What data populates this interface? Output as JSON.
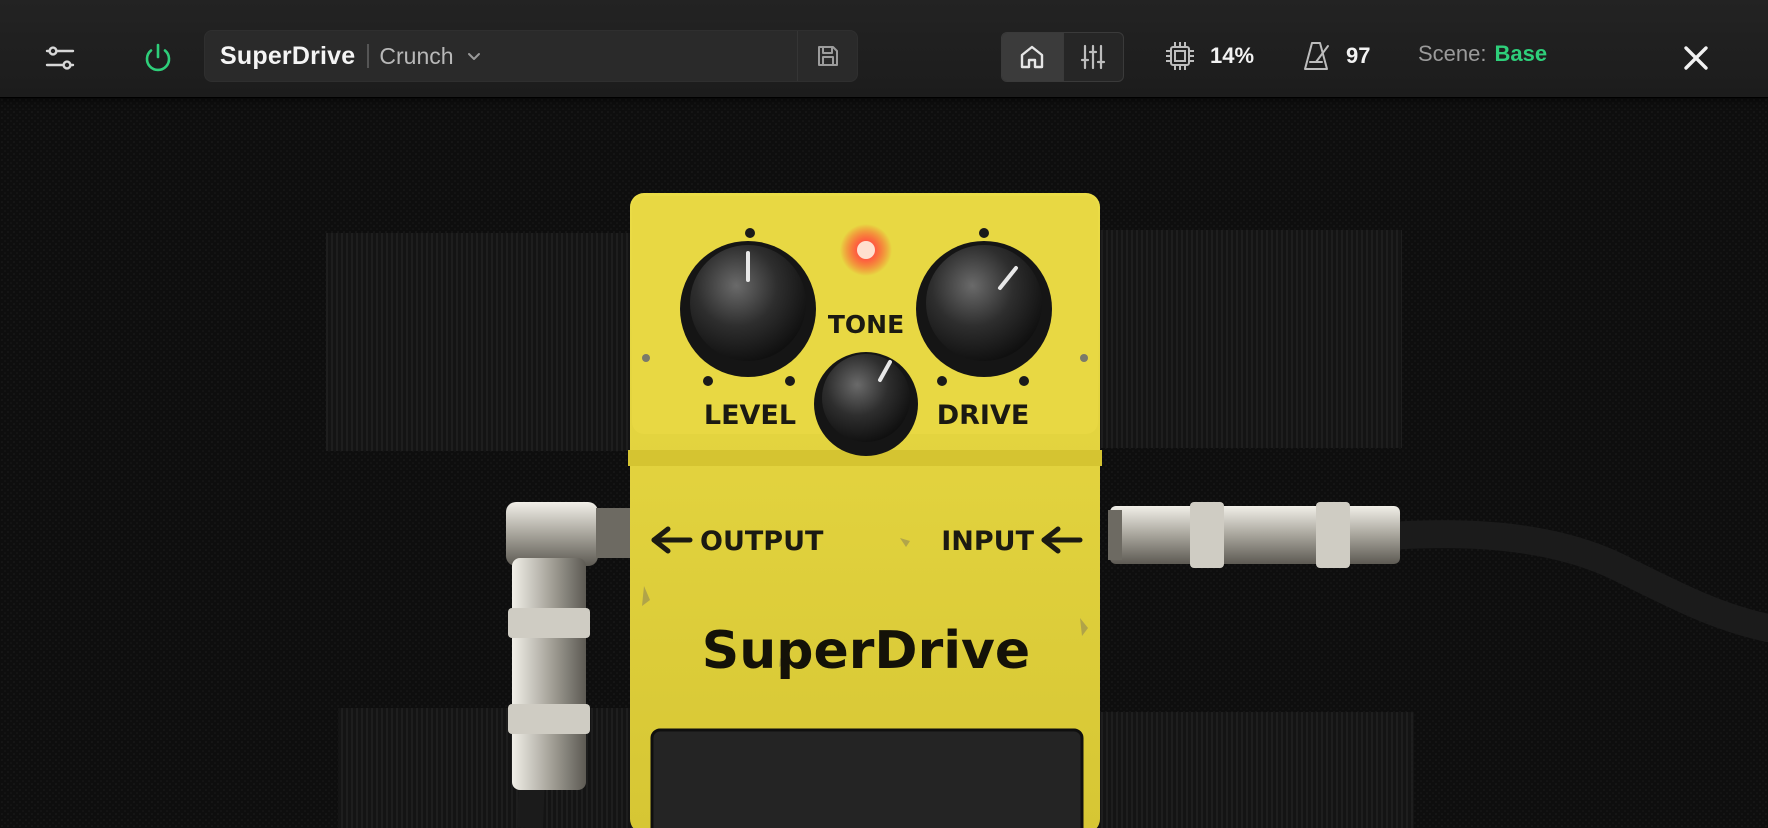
{
  "toolbar": {
    "preset_name": "SuperDrive",
    "preset_variant": "Crunch",
    "cpu_value": "14%",
    "tempo_value": "97",
    "scene_label": "Scene:",
    "scene_value": "Base",
    "power_state": "on",
    "active_view": "home",
    "icons": {
      "menu": "sliders-menu-icon",
      "power": "power-icon",
      "chevron": "chevron-down-icon",
      "save": "save-icon",
      "home": "home-icon",
      "mixer": "mixer-icon",
      "cpu": "cpu-icon",
      "tempo": "metronome-icon",
      "close": "close-icon"
    }
  },
  "pedal": {
    "knobs": {
      "level": "LEVEL",
      "tone": "TONE",
      "drive": "DRIVE"
    },
    "jacks": {
      "output": "OUTPUT",
      "input": "INPUT"
    },
    "brand": "SuperDrive",
    "led_state": "on"
  },
  "colors": {
    "accent_green": "#2ecf7a",
    "pedal_yellow": "#e4d43a",
    "led_red": "#ff4a3a",
    "bar_bg": "#1e1e1e"
  }
}
